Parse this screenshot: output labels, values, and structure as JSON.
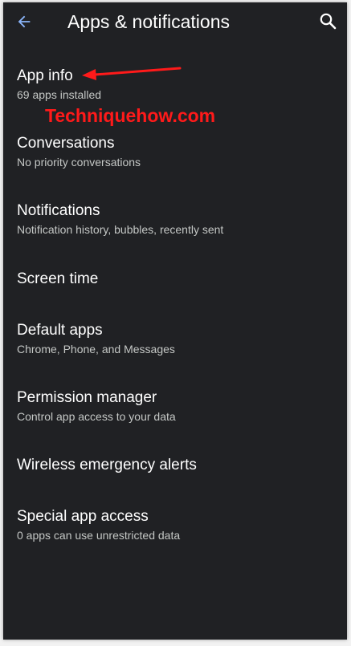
{
  "header": {
    "title": "Apps & notifications",
    "back_icon": "arrow-back-icon",
    "search_icon": "search-icon"
  },
  "colors": {
    "background": "#202124",
    "accent": "#8ab4f8",
    "annotation": "#ff1a1a"
  },
  "watermark": "Techniquehow.com",
  "items": [
    {
      "title": "App info",
      "subtitle": "69 apps installed"
    },
    {
      "title": "Conversations",
      "subtitle": "No priority conversations"
    },
    {
      "title": "Notifications",
      "subtitle": "Notification history, bubbles, recently sent"
    },
    {
      "title": "Screen time",
      "subtitle": ""
    },
    {
      "title": "Default apps",
      "subtitle": "Chrome, Phone, and Messages"
    },
    {
      "title": "Permission manager",
      "subtitle": "Control app access to your data"
    },
    {
      "title": "Wireless emergency alerts",
      "subtitle": ""
    },
    {
      "title": "Special app access",
      "subtitle": "0 apps can use unrestricted data"
    }
  ]
}
